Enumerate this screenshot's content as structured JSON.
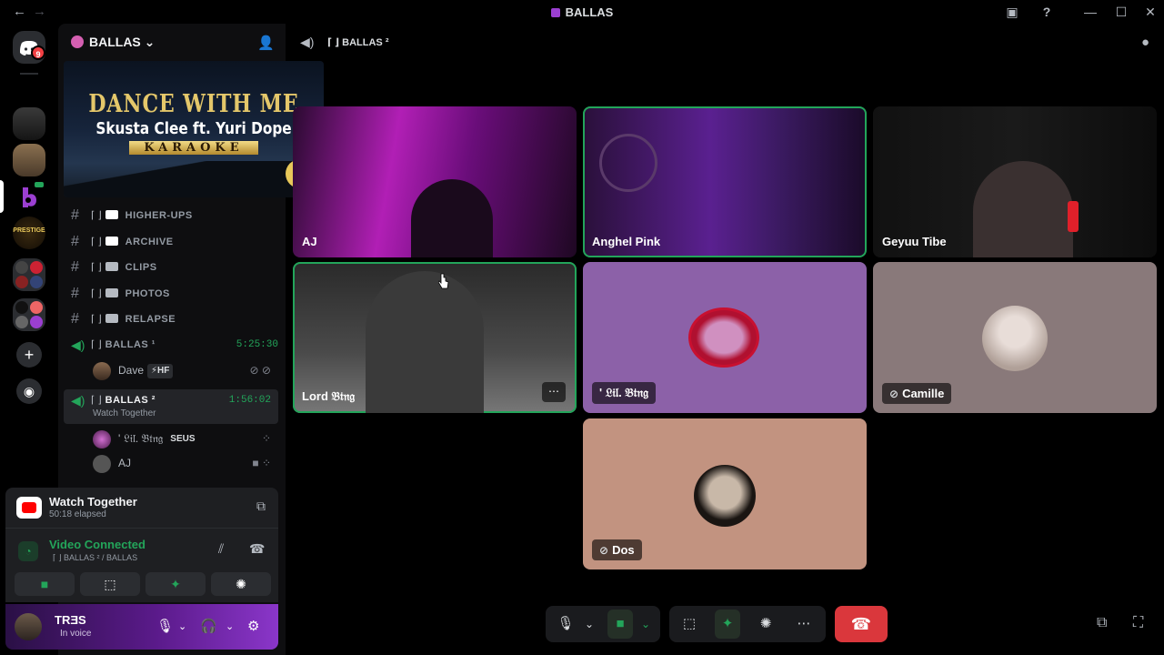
{
  "window": {
    "title": "BALLAS",
    "back": "←",
    "forward": "→",
    "minimize": "—",
    "maximize": "☐",
    "close": "✕"
  },
  "rail": {
    "dm_badge": "9"
  },
  "guild": {
    "name": "BALLAS ⌄"
  },
  "banner": {
    "line1": "DANCE WITH ME",
    "line2": "Skusta Clee ft. Yuri Dope",
    "line3": "KARAOKE",
    "logo": "TPY"
  },
  "channels": [
    {
      "name": "HIGHER-UPS",
      "prefix": "⌈ ⌋"
    },
    {
      "name": "ARCHIVE",
      "prefix": "⌈ ⌋"
    },
    {
      "name": "CLIPS",
      "prefix": "⌈ ⌋"
    },
    {
      "name": "PHOTOS",
      "prefix": "⌈ ⌋"
    },
    {
      "name": "RELAPSE",
      "prefix": "⌈ ⌋"
    }
  ],
  "voice_channels": [
    {
      "name": "BALLAS ¹",
      "prefix": "⌈ ⌋",
      "time": "5:25:30"
    },
    {
      "name": "BALLAS ²",
      "prefix": "⌈ ⌋",
      "time": "1:56:02",
      "sub": "Watch Together"
    }
  ],
  "voice_users": [
    {
      "name": "Dave",
      "tag": "⚡HF"
    },
    {
      "name": "' 𝔏𝔦𝔩. 𝔅𝔱𝔫𝔤",
      "tag": "SEUS"
    },
    {
      "name": "AJ",
      "tag": ""
    }
  ],
  "activity": {
    "title": "Watch Together",
    "elapsed": "50:18 elapsed"
  },
  "connection": {
    "status": "Video Connected",
    "channel": "⌈ ⌋ BALLAS ² / BALLAS"
  },
  "user": {
    "name": "TRƎS",
    "status": "In voice"
  },
  "header": {
    "channel": "⌈ ⌋ BALLAS ²"
  },
  "tiles": [
    {
      "name": "AJ"
    },
    {
      "name": "Anghel Pink"
    },
    {
      "name": "Geyuu Tibe"
    },
    {
      "name": "Lord 𝔅𝔱𝔫𝔤"
    },
    {
      "name": "' 𝔏𝔦𝔩. 𝔅𝔱𝔫𝔤"
    },
    {
      "name": "Camille"
    },
    {
      "name": "Dos"
    }
  ],
  "icons": {
    "mic": "🎙",
    "chevron": "⌄",
    "camera": "■",
    "share": "⬚",
    "activity": "✦",
    "soundboard": "✺",
    "more": "⋯",
    "hangup": "☎",
    "popout": "⧉",
    "fullscreen": "⛶",
    "chat": "💬"
  },
  "colors": {
    "connected": "#23a55a",
    "hangup": "#da373c",
    "speaking": "#23a55a",
    "tile_purple": "#8c61a8",
    "tile_gray": "#89797a",
    "tile_peach": "#c29380"
  }
}
